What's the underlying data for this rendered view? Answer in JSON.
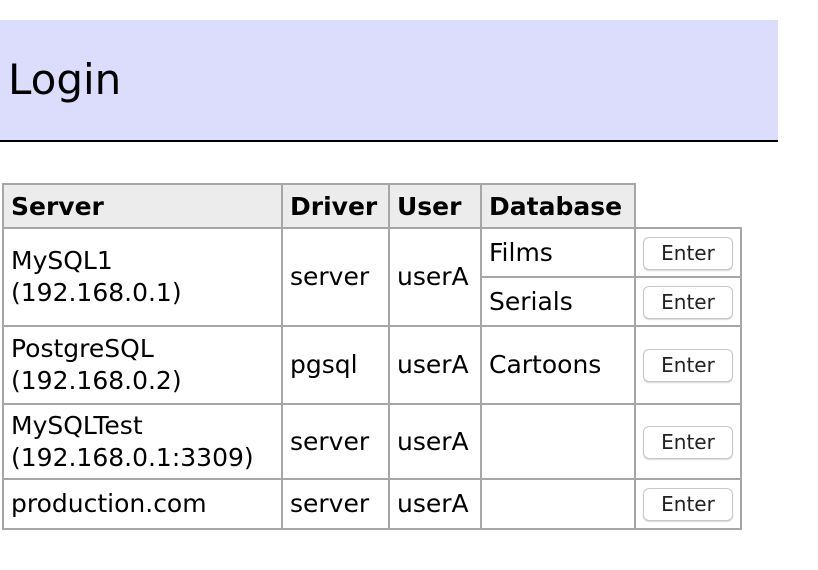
{
  "page": {
    "title": "Login"
  },
  "table": {
    "headers": {
      "server": "Server",
      "driver": "Driver",
      "user": "User",
      "database": "Database"
    },
    "rows": [
      {
        "server_name": "MySQL1",
        "server_addr": "(192.168.0.1)",
        "driver": "server",
        "user": "userA",
        "databases": [
          {
            "name": "Films",
            "button": "Enter"
          },
          {
            "name": "Serials",
            "button": "Enter"
          }
        ]
      },
      {
        "server_name": "PostgreSQL",
        "server_addr": "(192.168.0.2)",
        "driver": "pgsql",
        "user": "userA",
        "databases": [
          {
            "name": "Cartoons",
            "button": "Enter"
          }
        ]
      },
      {
        "server_name": "MySQLTest",
        "server_addr": "(192.168.0.1:3309)",
        "driver": "server",
        "user": "userA",
        "databases": [
          {
            "name": "",
            "button": "Enter"
          }
        ]
      },
      {
        "server_name": "production.com",
        "server_addr": "",
        "driver": "server",
        "user": "userA",
        "databases": [
          {
            "name": "",
            "button": "Enter"
          }
        ]
      }
    ]
  }
}
